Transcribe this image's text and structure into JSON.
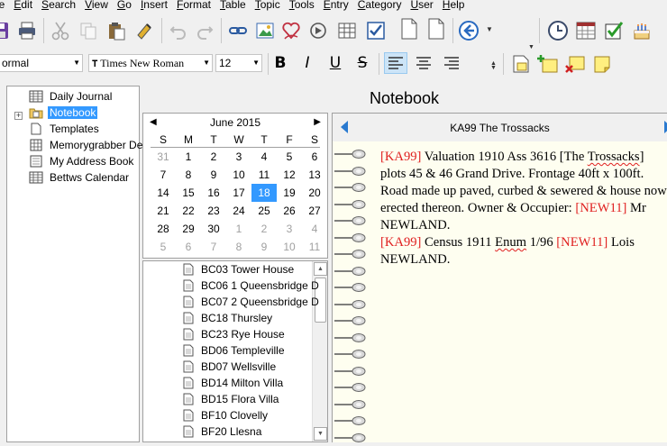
{
  "menubar": {
    "items": [
      {
        "label": "le",
        "u": ""
      },
      {
        "label": "Edit",
        "u": "E"
      },
      {
        "label": "Search",
        "u": "S"
      },
      {
        "label": "View",
        "u": "V"
      },
      {
        "label": "Go",
        "u": "G"
      },
      {
        "label": "Insert",
        "u": "I"
      },
      {
        "label": "Format",
        "u": "F"
      },
      {
        "label": "Table",
        "u": "T"
      },
      {
        "label": "Topic",
        "u": "T"
      },
      {
        "label": "Tools",
        "u": "T"
      },
      {
        "label": "Entry",
        "u": "E"
      },
      {
        "label": "Category",
        "u": "C"
      },
      {
        "label": "User",
        "u": "U"
      },
      {
        "label": "Help",
        "u": "H"
      }
    ]
  },
  "format_bar": {
    "style_value": "ormal",
    "font_value": "Times New Roman",
    "size_value": "12",
    "bold": "B",
    "italic": "I",
    "underline": "U",
    "strike": "S"
  },
  "tree": {
    "items": [
      {
        "label": "Daily Journal",
        "icon": "calendar-icon",
        "selected": false
      },
      {
        "label": "Notebook",
        "icon": "notebook-folder-icon",
        "selected": true
      },
      {
        "label": "Templates",
        "icon": "document-icon",
        "selected": false
      },
      {
        "label": "Memorygrabber De",
        "icon": "grid-document-icon",
        "selected": false
      },
      {
        "label": "My Address Book",
        "icon": "address-book-icon",
        "selected": false
      },
      {
        "label": "Bettws Calendar",
        "icon": "calendar-icon",
        "selected": false
      }
    ]
  },
  "notebook_title": "Notebook",
  "calendar": {
    "month_label": "June 2015",
    "dow": [
      "S",
      "M",
      "T",
      "W",
      "T",
      "F",
      "S"
    ],
    "weeks": [
      [
        "31",
        "1",
        "2",
        "3",
        "4",
        "5",
        "6"
      ],
      [
        "7",
        "8",
        "9",
        "10",
        "11",
        "12",
        "13"
      ],
      [
        "14",
        "15",
        "16",
        "17",
        "18",
        "19",
        "20"
      ],
      [
        "21",
        "22",
        "23",
        "24",
        "25",
        "26",
        "27"
      ],
      [
        "28",
        "29",
        "30",
        "1",
        "2",
        "3",
        "4"
      ],
      [
        "5",
        "6",
        "7",
        "8",
        "9",
        "10",
        "11"
      ]
    ],
    "selected_day": "18"
  },
  "page_list": {
    "items": [
      "BC03 Tower House",
      "BC06 1 Queensbridge D",
      "BC07 2 Queensbridge D",
      "BC18 Thursley",
      "BC23 Rye House",
      "BD06 Templeville",
      "BD07 Wellsville",
      "BD14 Milton Villa",
      "BD15 Flora Villa",
      "BF10 Clovelly",
      "BF20 Llesna"
    ]
  },
  "page": {
    "title": "KA99 The Trossacks",
    "tag1": "[KA99]",
    "text1a": " Valuation 1910 Ass 3616 [The ",
    "text1b": "Trossacks",
    "text1c": "] plots 45 & 46 Grand Drive. Frontage 40ft x 100ft. Road made up paved, curbed & sewered & house now erected thereon. Owner & Occupier: ",
    "tag2": "[NEW11]",
    "text1d": " Mr NEWLAND.",
    "tag3": "[KA99]",
    "text2a": " Census 1911 ",
    "text2b": "Enum",
    "text2c": " 1/96 ",
    "tag4": "[NEW11]",
    "text2d": " Lois NEWLAND."
  }
}
